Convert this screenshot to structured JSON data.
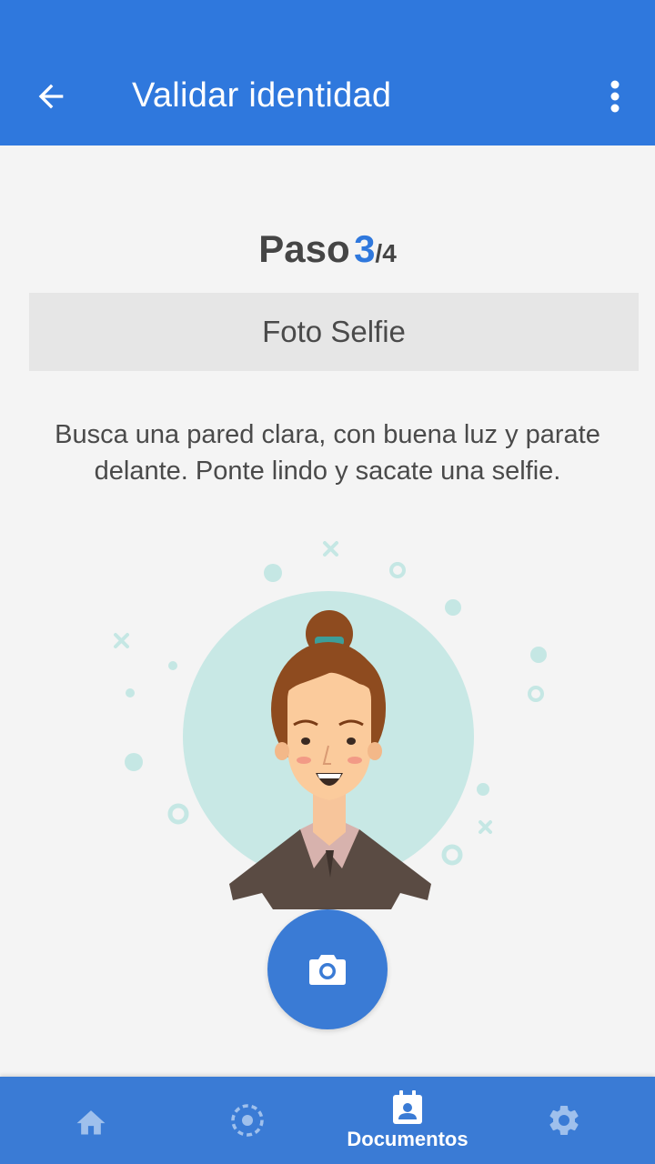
{
  "header": {
    "title": "Validar identidad",
    "back_icon": "arrow-back-icon",
    "menu_icon": "more-vert-icon",
    "color": "#2f78dd"
  },
  "step": {
    "label": "Paso",
    "current": "3",
    "separator": "/",
    "total": "4",
    "accent_color": "#2f78dd"
  },
  "section": {
    "title": "Foto Selfie"
  },
  "description": "Busca una pared clara, con buena luz y parate delante. Ponte lindo y sacate una selfie.",
  "camera_button": {
    "icon": "camera-icon",
    "color": "#3a7bd5"
  },
  "bottom_nav": {
    "items": [
      {
        "icon": "home-icon",
        "label": ""
      },
      {
        "icon": "scan-icon",
        "label": ""
      },
      {
        "icon": "documents-icon",
        "label": "Documentos",
        "active": true
      },
      {
        "icon": "gear-icon",
        "label": ""
      }
    ]
  }
}
